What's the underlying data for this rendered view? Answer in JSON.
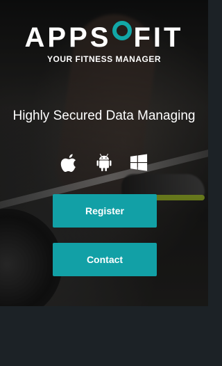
{
  "brand": {
    "logo_text_left": "APPS",
    "logo_text_o": "O",
    "logo_text_right": "FIT",
    "tagline": "YOUR FITNESS MANAGER",
    "accent_color": "#12a7a7"
  },
  "hero": {
    "headline": "Highly Secured Data Managing",
    "platform_icons": [
      "apple-icon",
      "android-icon",
      "windows-icon"
    ]
  },
  "actions": {
    "register_label": "Register",
    "contact_label": "Contact",
    "button_color": "#12a0a6"
  },
  "colors": {
    "footer_background": "#1c2226"
  }
}
